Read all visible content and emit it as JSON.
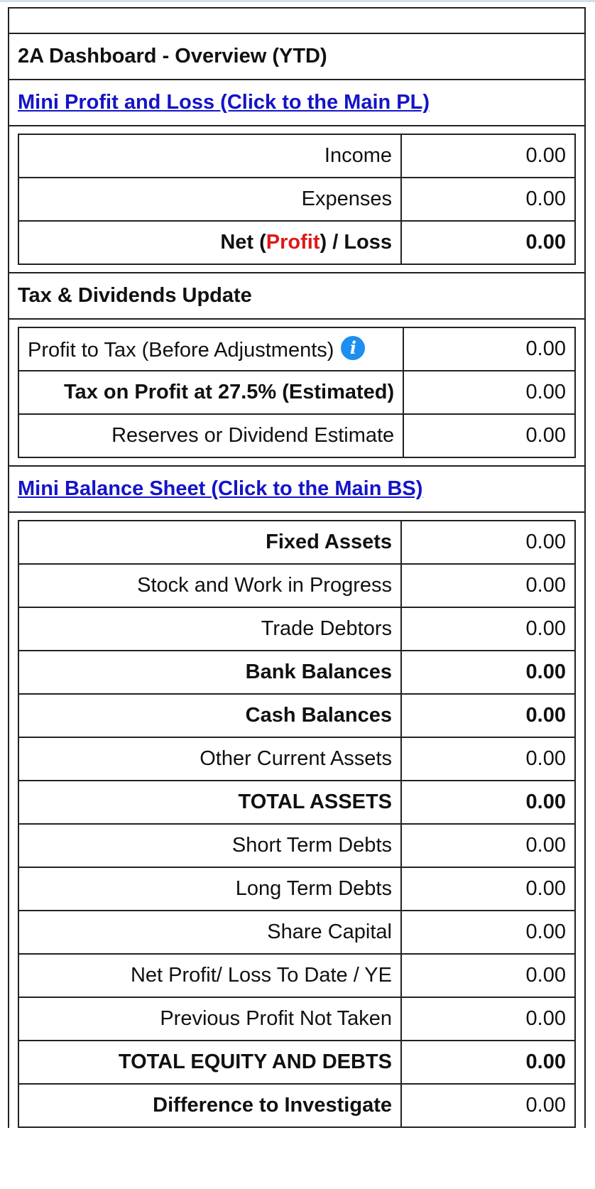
{
  "dashboard": {
    "title": "2A Dashboard - Overview (YTD)"
  },
  "profit_loss": {
    "link_label": "Mini Profit and Loss (Click to the Main PL)",
    "rows": [
      {
        "label": "Income",
        "value": "0.00"
      },
      {
        "label": "Expenses",
        "value": "0.00"
      }
    ],
    "net": {
      "prefix": "Net (",
      "profit_word": "Profit",
      "suffix": ") / Loss",
      "value": "0.00"
    }
  },
  "tax": {
    "heading": "Tax & Dividends Update",
    "info_icon_glyph": "i",
    "rows": [
      {
        "label": "Profit to Tax (Before Adjustments)",
        "value": "0.00"
      },
      {
        "label": "Tax on Profit at 27.5% (Estimated)",
        "value": "0.00"
      },
      {
        "label": "Reserves or Dividend Estimate",
        "value": "0.00"
      }
    ]
  },
  "balance_sheet": {
    "link_label": "Mini Balance Sheet (Click to the Main BS)",
    "rows": [
      {
        "label": "Fixed Assets",
        "value": "0.00"
      },
      {
        "label": "Stock and Work in Progress",
        "value": "0.00"
      },
      {
        "label": "Trade Debtors",
        "value": "0.00"
      },
      {
        "label": "Bank Balances",
        "value": "0.00"
      },
      {
        "label": "Cash Balances",
        "value": "0.00"
      },
      {
        "label": "Other Current Assets",
        "value": "0.00"
      },
      {
        "label": "TOTAL ASSETS",
        "value": "0.00"
      },
      {
        "label": "Short Term Debts",
        "value": "0.00"
      },
      {
        "label": "Long Term Debts",
        "value": "0.00"
      },
      {
        "label": "Share Capital",
        "value": "0.00"
      },
      {
        "label": "Net Profit/ Loss To Date / YE",
        "value": "0.00"
      },
      {
        "label": "Previous Profit Not Taken",
        "value": "0.00"
      },
      {
        "label": "TOTAL EQUITY AND DEBTS",
        "value": "0.00"
      },
      {
        "label": "Difference to Investigate",
        "value": "0.00"
      }
    ]
  },
  "colors": {
    "link": "#1414c8",
    "profit_highlight": "#e01818",
    "info_icon": "#1e8ef0"
  }
}
